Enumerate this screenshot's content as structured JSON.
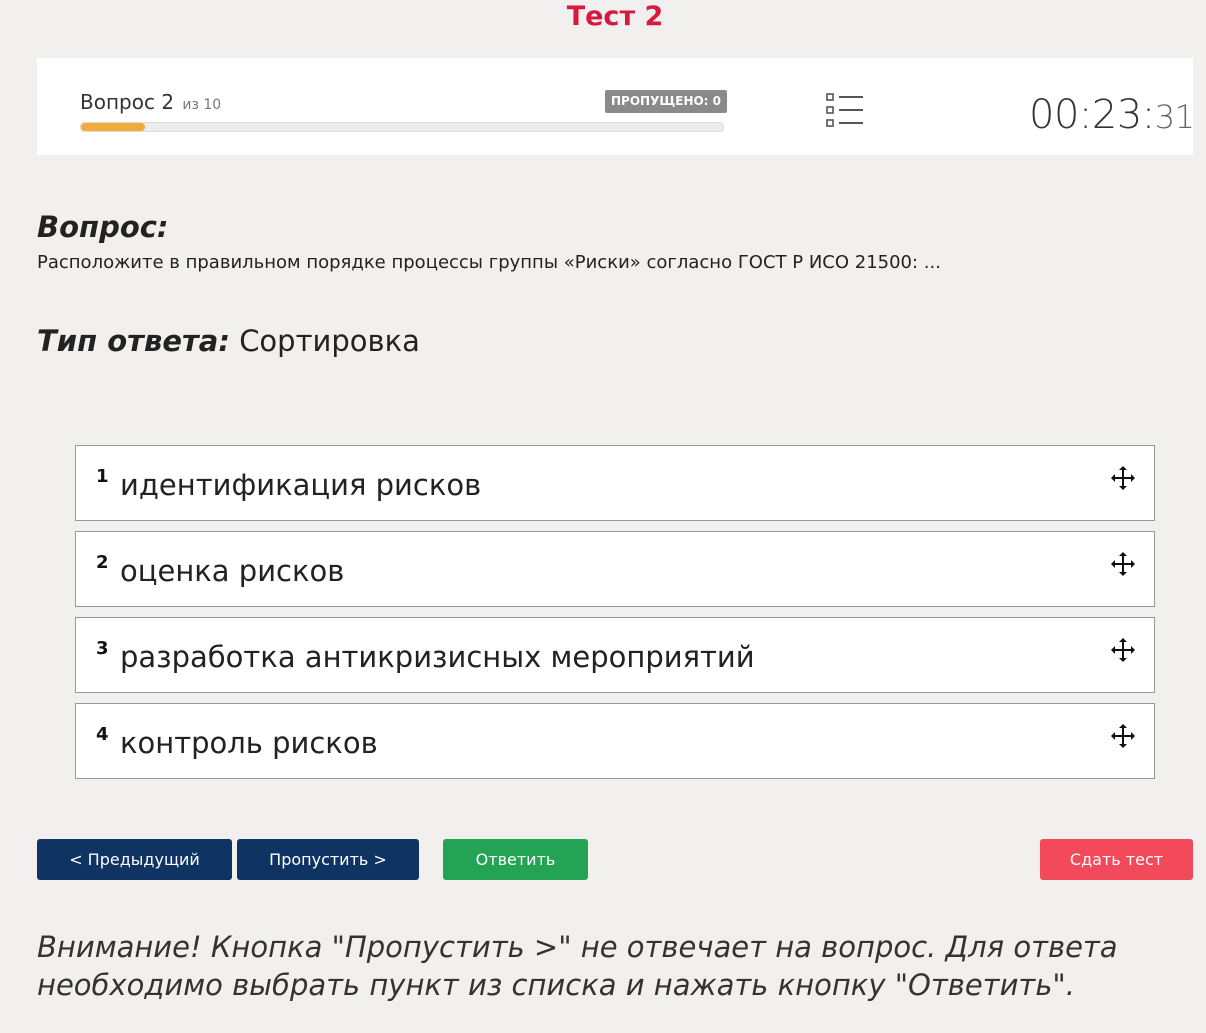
{
  "test_title": "Тест 2",
  "progress": {
    "question_label": "Вопрос 2",
    "question_total": "из 10",
    "current": 2,
    "total": 10,
    "fraction": 0.1,
    "skipped_label": "ПРОПУЩЕНО: 0",
    "list_icon": "list-icon"
  },
  "timer": {
    "main": "00:23:",
    "seconds": "31"
  },
  "question": {
    "heading": "Вопрос:",
    "text": "Расположите в правильном порядке процессы группы «Риски» согласно ГОСТ Р ИСО 21500: ..."
  },
  "answer_type": {
    "label": "Тип ответа:",
    "value": "Сортировка"
  },
  "sort_items": [
    {
      "number": "1",
      "label": "идентификация рисков",
      "icon": "move-icon"
    },
    {
      "number": "2",
      "label": "оценка рисков",
      "icon": "move-icon"
    },
    {
      "number": "3",
      "label": "разработка антикризисных мероприятий",
      "icon": "move-icon"
    },
    {
      "number": "4",
      "label": "контроль рисков",
      "icon": "move-icon"
    }
  ],
  "buttons": {
    "prev": "< Предыдущий",
    "skip": "Пропустить >",
    "answer": "Ответить",
    "submit": "Сдать тест"
  },
  "warning": "Внимание! Кнопка \"Пропустить >\" не отвечает на вопрос. Для ответа необходимо выбрать пункт из списка и нажать кнопку \"Ответить\".",
  "colors": {
    "title": "#d7193f",
    "progress_fill": "#f0ab3a",
    "nav_button": "#0f3363",
    "answer_button": "#23a455",
    "submit_button": "#f2495b",
    "skipped_badge": "#8a8a8a"
  }
}
